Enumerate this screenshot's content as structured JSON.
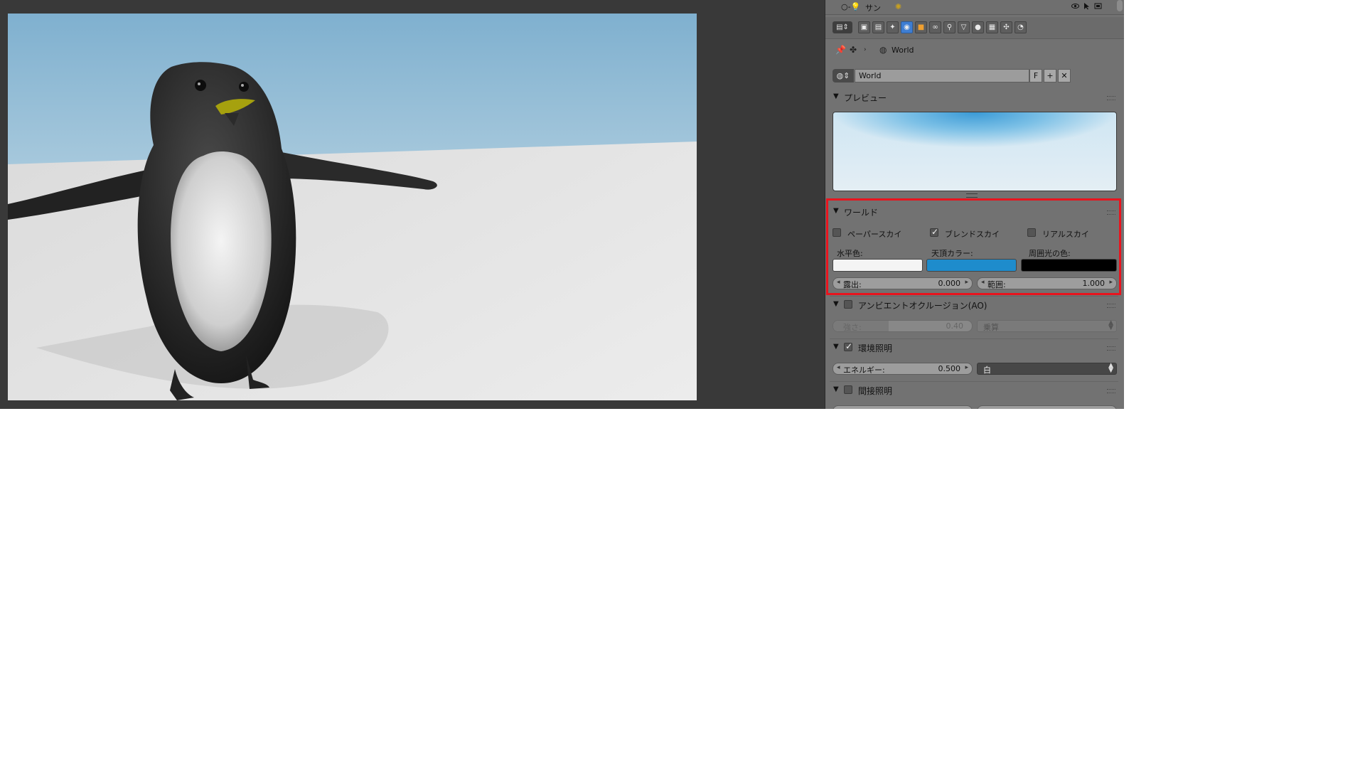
{
  "outliner": {
    "item_label": "サン"
  },
  "breadcrumb": {
    "world_label": "World"
  },
  "datablock": {
    "name": "World",
    "fake_user_label": "F",
    "add_label": "+",
    "unlink_label": "✕"
  },
  "preview_panel": {
    "title": "プレビュー"
  },
  "world_panel": {
    "title": "ワールド",
    "paper_sky": {
      "label": "ペーパースカイ",
      "checked": false
    },
    "blend_sky": {
      "label": "ブレンドスカイ",
      "checked": true
    },
    "real_sky": {
      "label": "リアルスカイ",
      "checked": false
    },
    "horizon_color_label": "水平色:",
    "zenith_color_label": "天頂カラー:",
    "ambient_color_label": "周囲光の色:",
    "horizon_color": "#f4f4f4",
    "zenith_color": "#1e8ccc",
    "ambient_color": "#000000",
    "exposure": {
      "label": "露出:",
      "value": "0.000"
    },
    "range": {
      "label": "範囲:",
      "value": "1.000"
    }
  },
  "ao_panel": {
    "title": "アンビエントオクルージョン(AO)",
    "enabled": false,
    "strength": {
      "label": "強さ:",
      "value": "0.40"
    },
    "blend_mode": "乗算"
  },
  "env_lighting_panel": {
    "title": "環境照明",
    "enabled": true,
    "energy": {
      "label": "エネルギー:",
      "value": "0.500"
    },
    "color_mode": "白"
  },
  "indirect_lighting_panel": {
    "title": "間接照明",
    "enabled": false
  },
  "colors": {
    "highlight": "#e8141e",
    "active_tab": "#3e7ed3"
  }
}
